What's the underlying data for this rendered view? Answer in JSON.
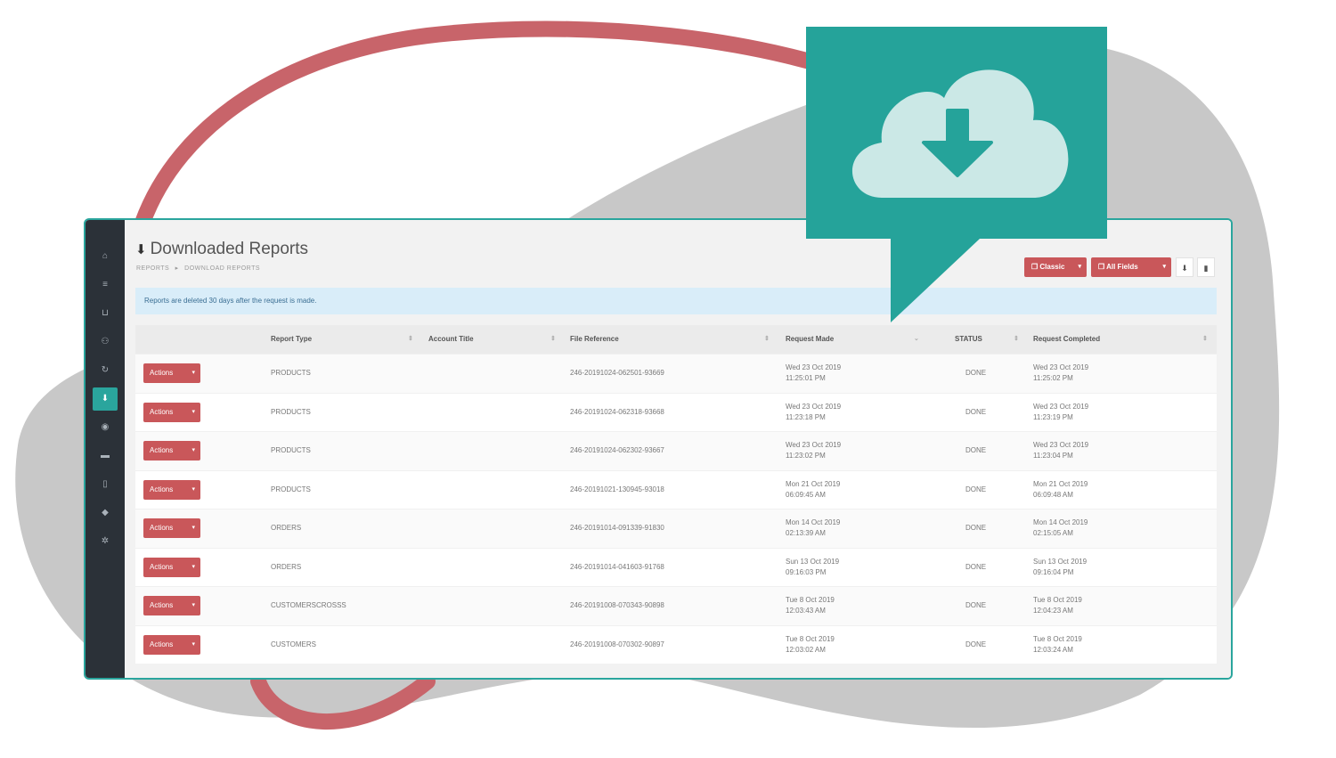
{
  "page": {
    "title": "Downloaded Reports",
    "title_icon": "download-icon",
    "breadcrumb": [
      "REPORTS",
      "▸",
      "DOWNLOAD REPORTS"
    ]
  },
  "toolbar": {
    "classic_label": "Classic",
    "fields_label": "All Fields",
    "caret": "▾",
    "download_icon": "download-icon",
    "trash_icon": "trash-icon"
  },
  "notice": "Reports are deleted 30 days after the request is made.",
  "table": {
    "headers": {
      "report_type": "Report Type",
      "account_title": "Account Title",
      "file_reference": "File Reference",
      "request_made": "Request Made",
      "status": "STATUS",
      "request_completed": "Request Completed"
    },
    "action_label": "Actions",
    "rows": [
      {
        "type": "PRODUCTS",
        "ref": "246-20191024-062501-93669",
        "made_date": "Wed 23 Oct 2019",
        "made_time": "11:25:01 PM",
        "status": "DONE",
        "done_date": "Wed 23 Oct 2019",
        "done_time": "11:25:02 PM"
      },
      {
        "type": "PRODUCTS",
        "ref": "246-20191024-062318-93668",
        "made_date": "Wed 23 Oct 2019",
        "made_time": "11:23:18 PM",
        "status": "DONE",
        "done_date": "Wed 23 Oct 2019",
        "done_time": "11:23:19 PM"
      },
      {
        "type": "PRODUCTS",
        "ref": "246-20191024-062302-93667",
        "made_date": "Wed 23 Oct 2019",
        "made_time": "11:23:02 PM",
        "status": "DONE",
        "done_date": "Wed 23 Oct 2019",
        "done_time": "11:23:04 PM"
      },
      {
        "type": "PRODUCTS",
        "ref": "246-20191021-130945-93018",
        "made_date": "Mon 21 Oct 2019",
        "made_time": "06:09:45 AM",
        "status": "DONE",
        "done_date": "Mon 21 Oct 2019",
        "done_time": "06:09:48 AM"
      },
      {
        "type": "ORDERS",
        "ref": "246-20191014-091339-91830",
        "made_date": "Mon 14 Oct 2019",
        "made_time": "02:13:39 AM",
        "status": "DONE",
        "done_date": "Mon 14 Oct 2019",
        "done_time": "02:15:05 AM"
      },
      {
        "type": "ORDERS",
        "ref": "246-20191014-041603-91768",
        "made_date": "Sun 13 Oct 2019",
        "made_time": "09:16:03 PM",
        "status": "DONE",
        "done_date": "Sun 13 Oct 2019",
        "done_time": "09:16:04 PM"
      },
      {
        "type": "CUSTOMERSCROSSS",
        "ref": "246-20191008-070343-90898",
        "made_date": "Tue 8 Oct 2019",
        "made_time": "12:03:43 AM",
        "status": "DONE",
        "done_date": "Tue 8 Oct 2019",
        "done_time": "12:04:23 AM"
      },
      {
        "type": "CUSTOMERS",
        "ref": "246-20191008-070302-90897",
        "made_date": "Tue 8 Oct 2019",
        "made_time": "12:03:02 AM",
        "status": "DONE",
        "done_date": "Tue 8 Oct 2019",
        "done_time": "12:03:24 AM"
      }
    ]
  },
  "sidebar": {
    "icons": [
      "home-icon",
      "list-icon",
      "basket-icon",
      "users-icon",
      "refresh-icon",
      "download-icon",
      "globe-icon",
      "briefcase-icon",
      "file-icon",
      "tag-icon",
      "gear-icon"
    ],
    "active_index": 5
  },
  "colors": {
    "accent": "#25a39a",
    "danger": "#c9575a",
    "sidebar": "#2b3138",
    "blob": "#c8c8c8",
    "ring": "#c8646a"
  },
  "badge_icon": "cloud-download-icon"
}
